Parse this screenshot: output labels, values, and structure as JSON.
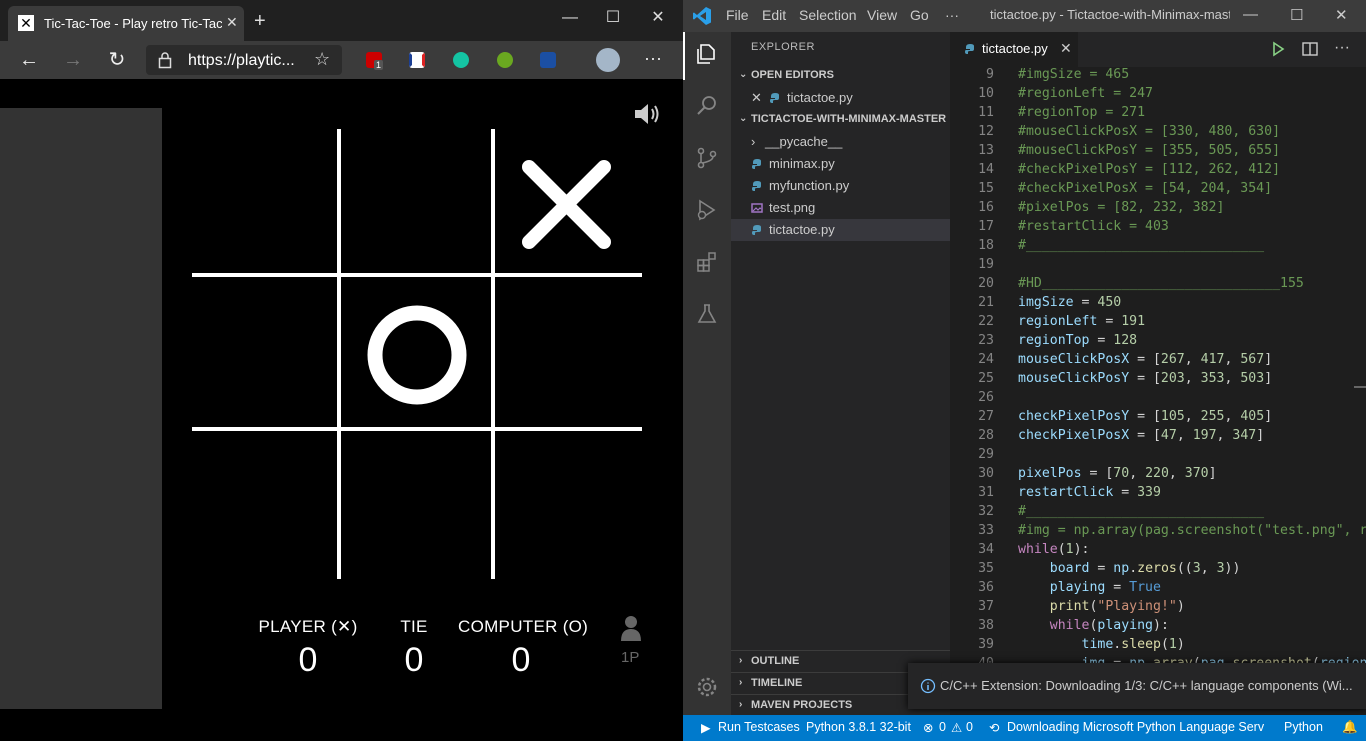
{
  "browser": {
    "tab_title": "Tic-Tac-Toe - Play retro Tic-Tac-Toe",
    "tab_close": "✕",
    "new_tab": "+",
    "url": "https://playtic...",
    "extension_badge": "1"
  },
  "game": {
    "board": [
      [
        "",
        "",
        "X"
      ],
      [
        "",
        "O",
        ""
      ],
      [
        "",
        "",
        ""
      ]
    ],
    "scores": [
      {
        "label": "PLAYER (✕)",
        "value": "0"
      },
      {
        "label": "TIE",
        "value": "0"
      },
      {
        "label": "COMPUTER (O)",
        "value": "0"
      }
    ],
    "mode_label": "1P"
  },
  "vscode": {
    "menu": [
      "File",
      "Edit",
      "Selection",
      "View",
      "Go",
      "···"
    ],
    "window_title": "tictactoe.py - Tictactoe-with-Minimax-master",
    "explorer_title": "EXPLORER",
    "open_editors_label": "OPEN EDITORS",
    "open_editor_file": "tictactoe.py",
    "project_label": "TICTACTOE-WITH-MINIMAX-MASTER",
    "files": [
      {
        "name": "__pycache__",
        "kind": "folder"
      },
      {
        "name": "minimax.py",
        "kind": "py"
      },
      {
        "name": "myfunction.py",
        "kind": "py"
      },
      {
        "name": "test.png",
        "kind": "png"
      },
      {
        "name": "tictactoe.py",
        "kind": "py"
      }
    ],
    "outline_label": "OUTLINE",
    "timeline_label": "TIMELINE",
    "maven_label": "MAVEN PROJECTS",
    "editor_tab": "tictactoe.py",
    "code_lines": [
      {
        "n": "9",
        "t": "#imgSize = 465"
      },
      {
        "n": "10",
        "t": "#regionLeft = 247"
      },
      {
        "n": "11",
        "t": "#regionTop = 271"
      },
      {
        "n": "12",
        "t": "#mouseClickPosX = [330, 480, 630]"
      },
      {
        "n": "13",
        "t": "#mouseClickPosY = [355, 505, 655]"
      },
      {
        "n": "14",
        "t": "#checkPixelPosY = [112, 262, 412]"
      },
      {
        "n": "15",
        "t": "#checkPixelPosX = [54, 204, 354]"
      },
      {
        "n": "16",
        "t": "#pixelPos = [82, 232, 382]"
      },
      {
        "n": "17",
        "t": "#restartClick = 403"
      },
      {
        "n": "18",
        "t": "#______________________________"
      },
      {
        "n": "19",
        "t": ""
      },
      {
        "n": "20",
        "t": "#HD______________________________155"
      },
      {
        "n": "21",
        "t": "imgSize = 450"
      },
      {
        "n": "22",
        "t": "regionLeft = 191"
      },
      {
        "n": "23",
        "t": "regionTop = 128"
      },
      {
        "n": "24",
        "t": "mouseClickPosX = [267, 417, 567]"
      },
      {
        "n": "25",
        "t": "mouseClickPosY = [203, 353, 503]"
      },
      {
        "n": "26",
        "t": ""
      },
      {
        "n": "27",
        "t": "checkPixelPosY = [105, 255, 405]"
      },
      {
        "n": "28",
        "t": "checkPixelPosX = [47, 197, 347]"
      },
      {
        "n": "29",
        "t": ""
      },
      {
        "n": "30",
        "t": "pixelPos = [70, 220, 370]"
      },
      {
        "n": "31",
        "t": "restartClick = 339"
      },
      {
        "n": "32",
        "t": "#______________________________"
      },
      {
        "n": "33",
        "t": "#img = np.array(pag.screenshot(\"test.png\", reg"
      },
      {
        "n": "34",
        "t": "while(1):"
      },
      {
        "n": "35",
        "t": "    board = np.zeros((3, 3))"
      },
      {
        "n": "36",
        "t": "    playing = True"
      },
      {
        "n": "37",
        "t": "    print(\"Playing!\")"
      },
      {
        "n": "38",
        "t": "    while(playing):"
      },
      {
        "n": "39",
        "t": "        time.sleep(1)"
      },
      {
        "n": "40",
        "t": "        img = np.array(pag.screenshot(region"
      }
    ],
    "notification": "C/C++ Extension: Downloading 1/3: C/C++ language components (Wi...",
    "status": {
      "run_testcases": "Run Testcases",
      "python_version": "Python 3.8.1 32-bit",
      "errors": "0",
      "warnings": "0",
      "downloading": "Downloading Microsoft Python Language Serv",
      "language": "Python"
    }
  },
  "colors": {
    "vscode_accent": "#007acc",
    "comment": "#6a9955",
    "keyword": "#c586c0"
  }
}
